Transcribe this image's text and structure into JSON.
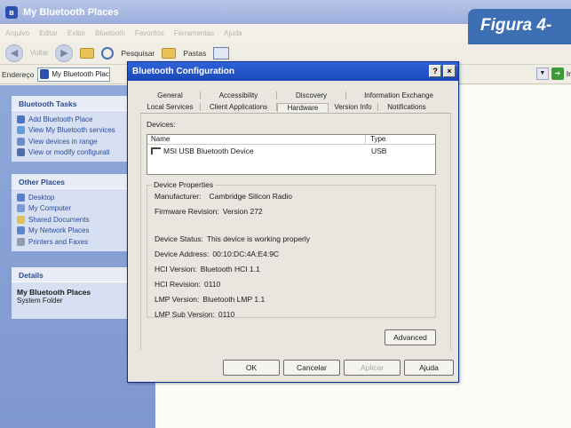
{
  "explorer": {
    "title": "My Bluetooth Places",
    "menu": [
      "Arquivo",
      "Editar",
      "Exibir",
      "Bluetooth",
      "Favoritos",
      "Ferramentas",
      "Ajuda"
    ],
    "toolbar": {
      "back": "Voltar",
      "search": "Pesquisar",
      "folders": "Pastas"
    },
    "address_label": "Endereço",
    "address_value": "My Bluetooth Plac",
    "go_label": "Ir"
  },
  "figure_label": "Figura 4-",
  "taskpane": {
    "bluetooth_tasks": {
      "title": "Bluetooth Tasks",
      "items": [
        "Add Bluetooth Place",
        "View My Bluetooth services",
        "View devices in range",
        "View or modify configurati"
      ]
    },
    "other_places": {
      "title": "Other Places",
      "items": [
        "Desktop",
        "My Computer",
        "Shared Documents",
        "My Network Places",
        "Printers and Faxes"
      ]
    },
    "details": {
      "title": "Details",
      "name": "My Bluetooth Places",
      "subtitle": "System Folder"
    }
  },
  "dialog": {
    "title": "Bluetooth Configuration",
    "help_button": "?",
    "close_button": "×",
    "tabs_row1": [
      "General",
      "Accessibility",
      "Discovery",
      "Information Exchange"
    ],
    "tabs_row2": [
      "Local Services",
      "Client Applications",
      "Hardware",
      "Version Info",
      "Notifications"
    ],
    "active_tab": "Hardware",
    "devices_label": "Devices:",
    "devices_columns": {
      "name": "Name",
      "type": "Type"
    },
    "devices": [
      {
        "name": "MSI USB Bluetooth Device",
        "type": "USB"
      }
    ],
    "properties": {
      "title": "Device Properties",
      "manufacturer": {
        "label": "Manufacturer:",
        "value": "Cambridge Silicon Radio"
      },
      "firmware": {
        "label": "Firmware Revision:",
        "value": "Version 272"
      },
      "status": {
        "label": "Device Status:",
        "value": "This device is working properly"
      },
      "address": {
        "label": "Device Address:",
        "value": "00:10:DC:4A:E4:9C"
      },
      "hci_version": {
        "label": "HCI Version:",
        "value": "Bluetooth HCI 1.1"
      },
      "hci_revision": {
        "label": "HCI Revision:",
        "value": "0110"
      },
      "lmp_version": {
        "label": "LMP Version:",
        "value": "Bluetooth LMP 1.1"
      },
      "lmp_subversion": {
        "label": "LMP Sub Version:",
        "value": "0110"
      }
    },
    "advanced_button": "Advanced",
    "buttons": {
      "ok": "OK",
      "cancel": "Cancelar",
      "apply": "Aplicar",
      "help": "Ajuda"
    }
  },
  "colors": {
    "title_blue": "#2e62d8",
    "taskpane_blue": "#8ea8d9",
    "figure_blue": "#3d6fb4"
  }
}
